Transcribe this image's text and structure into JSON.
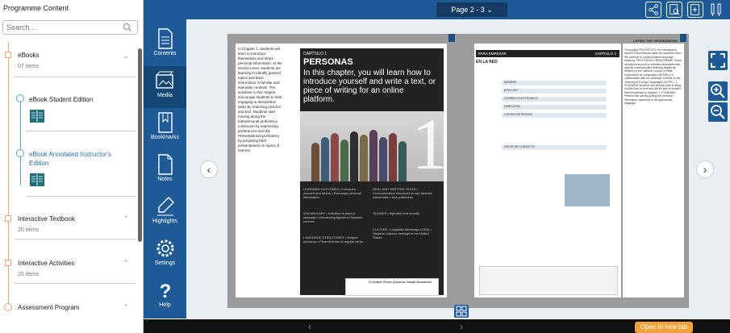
{
  "sidebar": {
    "title": "Programme Content",
    "search_placeholder": "Search...",
    "sections": [
      {
        "label": "eBooks",
        "count": "07 items"
      },
      {
        "label": "Interactive Textbook",
        "count": "20 items"
      },
      {
        "label": "Interactive Activities",
        "count": "20 items"
      },
      {
        "label": "Assessment Program",
        "count": ""
      }
    ],
    "ebooks": [
      {
        "label": "eBook Student Edition"
      },
      {
        "label": "eBook Annotated Instructor's Edition"
      }
    ]
  },
  "toolbar": {
    "items": [
      "Contents",
      "Media",
      "Bookmarks",
      "Notes",
      "Highlights",
      "Settings",
      "Help"
    ]
  },
  "header": {
    "page_selector": "Page 2 - 3"
  },
  "book": {
    "left_intro": "In Chapter 1, students will learn to introduce themselves and share personal information. At the Novice Level, students are learning to identify general topics and basic information in familiar and everyday contexts. The activities in this chapter encourage students to start engaging in Interpretive tasks by matching pictures and text. Students start moving along the Interpersonal proficiency continuum by expressing preferences and the Presentational proficiency by preparing brief presentations on topics of interest.",
    "chapter_label": "CAPÍTULO 1",
    "chapter_title": "PERSONAS",
    "chapter_subtitle": "In this chapter, you will learn how to introduce yourself and write a text, or piece of writing for an online platform.",
    "chapter_number": "1",
    "objectives": [
      "LEARNING OUTCOMES • Introduce yourself and others • Exchange personal information",
      "ORAL AND WRITTEN TEXTS • Communication resources to say Spanish classmates • Use politeness",
      "VOCABULARY • Activities to learn a language • Introducing figures to Spanish courses",
      "SOUNDS • Alphabet and sounds",
      "LANGUAGE STRUCTURES • Subject pronouns • Present tense of regular verbs",
      "CULTURE • Linguistic landscape (USA) • Hispanic cultures heritage in the United States"
    ],
    "right_header_left": "PARA EMPEZAR",
    "right_header_right": "CAPÍTULO 1",
    "right_subtitle": "EN LA RED",
    "form_fields": [
      "NOMBRE",
      "APELLIDO",
      "CORREO ELECTRÓNICO",
      "DIRECCIÓN",
      "CÓDIGO DE REGIÓN",
      "DATOS DE CONTACTO"
    ],
    "margin_heading": "LAYING THE GROUNDWORK",
    "margin_text": "Throughout PROYECTOS, the introductory section Para empezar takes its inspiration from the contexts of communicative language teaching. PROFICIENCY BENCHMARK These introductions point to activities associated with specific communicative learning targets as defined by the National Council of State Supervisors for Languages (NCSSFL) in collaboration with the American Council on the Teaching of Foreign Languages (ACTFL). 1. PLANNING Students are already used to filling out this kind of form and will be able to transfer their knowledge to Spanish. 2. PLANNING Present this activity putting the personal information questions in the appropriate language.",
    "badge_text": "24 Multiple Choice Questions Sample Assessment"
  },
  "bottom": {
    "open_tab": "Open in new tab",
    "prev": "‹",
    "next": "›"
  }
}
